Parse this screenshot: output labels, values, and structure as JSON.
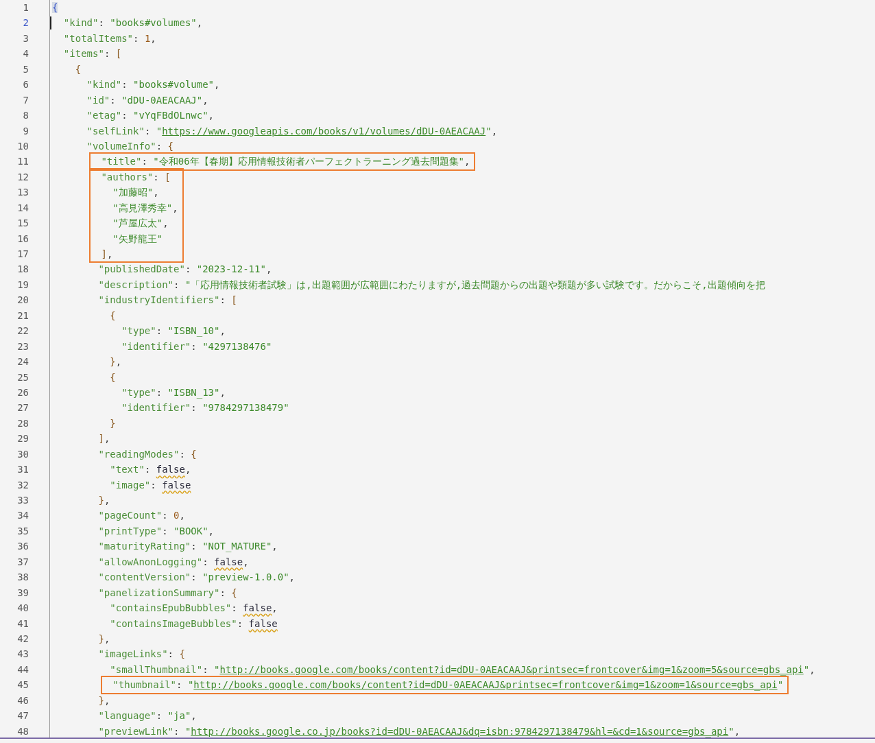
{
  "editor": {
    "blocks": [
      {
        "highlighted": false,
        "lines": [
          {
            "number": "1",
            "text": "{",
            "current": false
          },
          {
            "number": "2",
            "text": "  \"kind\": \"books#volumes\",",
            "current": true
          },
          {
            "number": "3",
            "text": "  \"totalItems\": 1,",
            "current": false
          },
          {
            "number": "4",
            "text": "  \"items\": [",
            "current": false
          },
          {
            "number": "5",
            "text": "    {",
            "current": false
          },
          {
            "number": "6",
            "text": "      \"kind\": \"books#volume\",",
            "current": false
          },
          {
            "number": "7",
            "text": "      \"id\": \"dDU-0AEACAAJ\",",
            "current": false
          },
          {
            "number": "8",
            "text": "      \"etag\": \"vYqFBdOLnwc\",",
            "current": false
          },
          {
            "number": "9",
            "text": "      \"selfLink\": \"https://www.googleapis.com/books/v1/volumes/dDU-0AEACAAJ\",",
            "current": false
          },
          {
            "number": "10",
            "text": "      \"volumeInfo\": {",
            "current": false
          }
        ]
      },
      {
        "highlighted": true,
        "lines": [
          {
            "number": "11",
            "text": "        \"title\": \"令和06年【春期】応用情報技術者パーフェクトラーニング過去問題集\",",
            "current": false
          }
        ]
      },
      {
        "highlighted": true,
        "lines": [
          {
            "number": "12",
            "text": "        \"authors\": [",
            "current": false
          },
          {
            "number": "13",
            "text": "          \"加藤昭\",",
            "current": false
          },
          {
            "number": "14",
            "text": "          \"高見澤秀幸\",",
            "current": false
          },
          {
            "number": "15",
            "text": "          \"芦屋広太\",",
            "current": false
          },
          {
            "number": "16",
            "text": "          \"矢野龍王\"",
            "current": false
          },
          {
            "number": "17",
            "text": "        ],",
            "current": false
          }
        ]
      },
      {
        "highlighted": false,
        "lines": [
          {
            "number": "18",
            "text": "        \"publishedDate\": \"2023-12-11\",",
            "current": false
          },
          {
            "number": "19",
            "text": "        \"description\": \"「応用情報技術者試験」は,出題範囲が広範囲にわたりますが,過去問題からの出題や類題が多い試験です。だからこそ,出題傾向を把",
            "current": false
          },
          {
            "number": "20",
            "text": "        \"industryIdentifiers\": [",
            "current": false
          },
          {
            "number": "21",
            "text": "          {",
            "current": false
          },
          {
            "number": "22",
            "text": "            \"type\": \"ISBN_10\",",
            "current": false
          },
          {
            "number": "23",
            "text": "            \"identifier\": \"4297138476\"",
            "current": false
          },
          {
            "number": "24",
            "text": "          },",
            "current": false
          },
          {
            "number": "25",
            "text": "          {",
            "current": false
          },
          {
            "number": "26",
            "text": "            \"type\": \"ISBN_13\",",
            "current": false
          },
          {
            "number": "27",
            "text": "            \"identifier\": \"9784297138479\"",
            "current": false
          },
          {
            "number": "28",
            "text": "          }",
            "current": false
          },
          {
            "number": "29",
            "text": "        ],",
            "current": false
          },
          {
            "number": "30",
            "text": "        \"readingModes\": {",
            "current": false
          },
          {
            "number": "31",
            "text": "          \"text\": false,",
            "current": false
          },
          {
            "number": "32",
            "text": "          \"image\": false",
            "current": false
          },
          {
            "number": "33",
            "text": "        },",
            "current": false
          },
          {
            "number": "34",
            "text": "        \"pageCount\": 0,",
            "current": false
          },
          {
            "number": "35",
            "text": "        \"printType\": \"BOOK\",",
            "current": false
          },
          {
            "number": "36",
            "text": "        \"maturityRating\": \"NOT_MATURE\",",
            "current": false
          },
          {
            "number": "37",
            "text": "        \"allowAnonLogging\": false,",
            "current": false
          },
          {
            "number": "38",
            "text": "        \"contentVersion\": \"preview-1.0.0\",",
            "current": false
          },
          {
            "number": "39",
            "text": "        \"panelizationSummary\": {",
            "current": false
          },
          {
            "number": "40",
            "text": "          \"containsEpubBubbles\": false,",
            "current": false
          },
          {
            "number": "41",
            "text": "          \"containsImageBubbles\": false",
            "current": false
          },
          {
            "number": "42",
            "text": "        },",
            "current": false
          },
          {
            "number": "43",
            "text": "        \"imageLinks\": {",
            "current": false
          },
          {
            "number": "44",
            "text": "          \"smallThumbnail\": \"http://books.google.com/books/content?id=dDU-0AEACAAJ&printsec=frontcover&img=1&zoom=5&source=gbs_api\",",
            "current": false
          }
        ]
      },
      {
        "highlighted": true,
        "lines": [
          {
            "number": "45",
            "text": "          \"thumbnail\": \"http://books.google.com/books/content?id=dDU-0AEACAAJ&printsec=frontcover&img=1&zoom=1&source=gbs_api\"",
            "current": false
          }
        ]
      },
      {
        "highlighted": false,
        "lines": [
          {
            "number": "46",
            "text": "        },",
            "current": false
          },
          {
            "number": "47",
            "text": "        \"language\": \"ja\",",
            "current": false
          },
          {
            "number": "48",
            "text": "        \"previewLink\": \"http://books.google.co.jp/books?id=dDU-0AEACAAJ&dq=isbn:9784297138479&hl=&cd=1&source=gbs_api\",",
            "current": false
          }
        ]
      }
    ]
  }
}
